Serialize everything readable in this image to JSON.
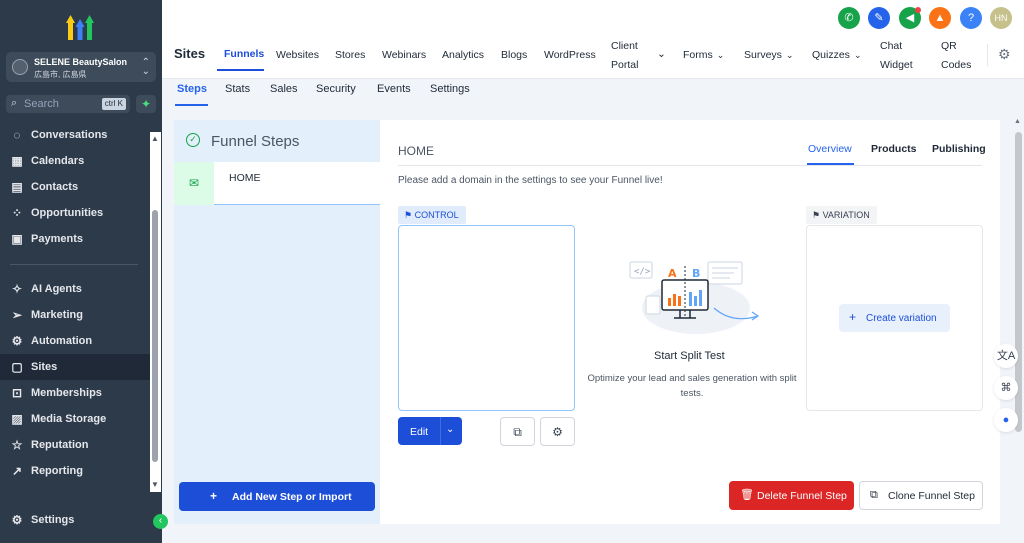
{
  "sidebar": {
    "account": {
      "name": "SELENE BeautySalon",
      "location": "広島市, 広島県"
    },
    "search": {
      "placeholder": "Search",
      "shortcut": "ctrl K"
    },
    "items": [
      {
        "label": "Conversations",
        "icon": "chat-icon"
      },
      {
        "label": "Calendars",
        "icon": "calendar-icon"
      },
      {
        "label": "Contacts",
        "icon": "contacts-icon"
      },
      {
        "label": "Opportunities",
        "icon": "opportunities-icon"
      },
      {
        "label": "Payments",
        "icon": "payments-icon"
      },
      {
        "label": "AI Agents",
        "icon": "sparkle-icon"
      },
      {
        "label": "Marketing",
        "icon": "send-icon"
      },
      {
        "label": "Automation",
        "icon": "automation-icon"
      },
      {
        "label": "Sites",
        "icon": "sites-icon",
        "active": true
      },
      {
        "label": "Memberships",
        "icon": "memberships-icon"
      },
      {
        "label": "Media Storage",
        "icon": "media-icon"
      },
      {
        "label": "Reputation",
        "icon": "star-icon"
      },
      {
        "label": "Reporting",
        "icon": "chart-icon"
      }
    ],
    "settings_label": "Settings"
  },
  "topbar": {
    "user_initials": "HN",
    "icon_colors": {
      "phone": "#16a34a",
      "ticket": "#2563eb",
      "megaphone": "#16a34a",
      "bell": "#f97316",
      "help": "#3b82f6",
      "avatar": "#c6c08a"
    }
  },
  "header": {
    "title": "Sites",
    "tabs": [
      {
        "label": "Funnels",
        "active": true
      },
      {
        "label": "Websites"
      },
      {
        "label": "Stores"
      },
      {
        "label": "Webinars"
      },
      {
        "label": "Analytics"
      },
      {
        "label": "Blogs"
      },
      {
        "label": "WordPress"
      },
      {
        "label1": "Client",
        "label2": "Portal"
      },
      {
        "label": "Forms"
      },
      {
        "label": "Surveys"
      },
      {
        "label": "Quizzes"
      },
      {
        "label1": "Chat",
        "label2": "Widget"
      },
      {
        "label1": "QR",
        "label2": "Codes"
      }
    ]
  },
  "subtabs": [
    {
      "label": "Steps",
      "active": true
    },
    {
      "label": "Stats"
    },
    {
      "label": "Sales"
    },
    {
      "label": "Security"
    },
    {
      "label": "Events"
    },
    {
      "label": "Settings"
    }
  ],
  "steps_panel": {
    "title": "Funnel Steps",
    "steps": [
      {
        "label": "HOME"
      }
    ],
    "add_button": "Add New Step or Import"
  },
  "main": {
    "title": "HOME",
    "tabs": [
      {
        "label": "Overview",
        "active": true
      },
      {
        "label": "Products"
      },
      {
        "label": "Publishing"
      }
    ],
    "notice": "Please add a domain in the settings to see your Funnel live!",
    "control_label": "CONTROL",
    "edit_label": "Edit",
    "split_title": "Start Split Test",
    "split_desc": "Optimize your lead and sales generation with split tests.",
    "variation_label": "VARIATION",
    "create_variation": "Create variation",
    "delete_button": "Delete Funnel Step",
    "clone_button": "Clone Funnel Step",
    "illustration_letters": {
      "a": "A",
      "b": "B"
    }
  }
}
